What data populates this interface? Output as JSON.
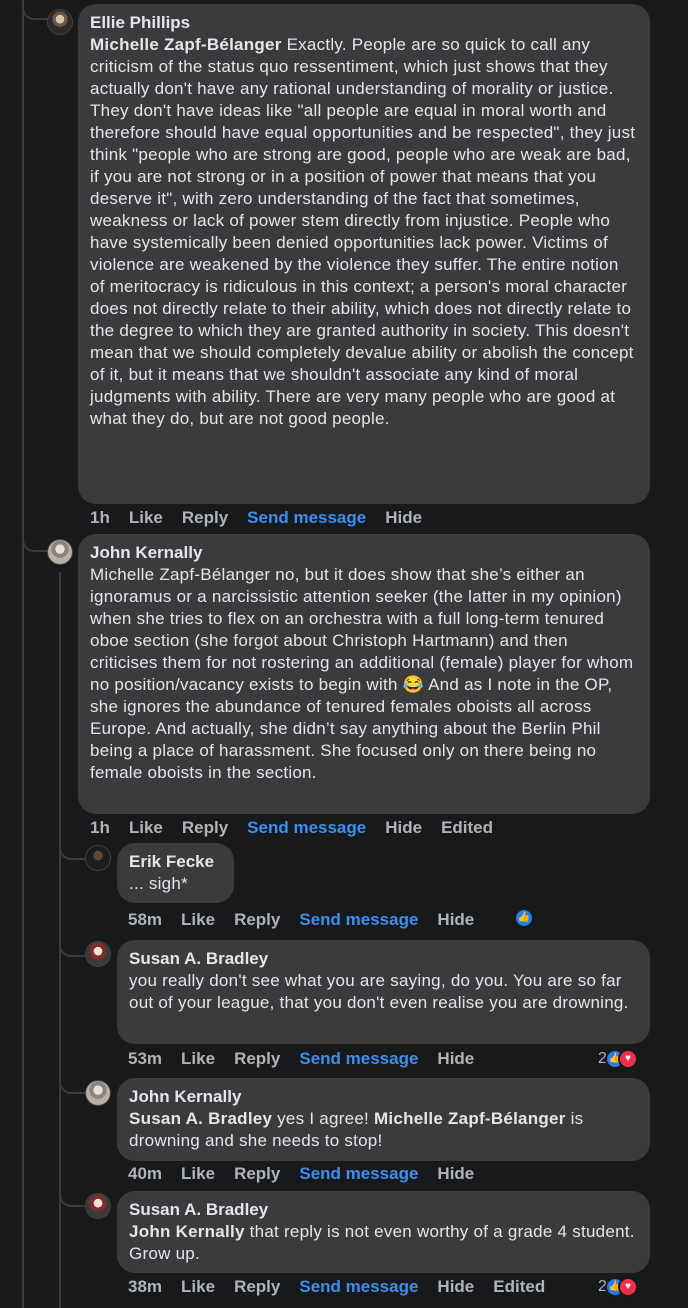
{
  "comments": [
    {
      "author": "Ellie Phillips",
      "mention": "Michelle Zapf-Bélanger",
      "text": " Exactly. People are so quick to call any criticism of the status quo ressentiment, which just shows that they actually don't have any rational understanding of morality or justice. They don't have ideas like \"all people are equal in moral worth and therefore should have equal opportunities and be respected\", they just think \"people who are strong are good, people who are weak are bad, if you are not strong or in a position of power that means that you deserve it\", with zero understanding of the fact that sometimes, weakness or lack of power stem directly from injustice. People who have systemically been denied opportunities lack power. Victims of violence are weakened by the violence they suffer. The entire notion of meritocracy is ridiculous in this context; a person's moral character does not directly relate to their ability, which does not directly relate to the degree to which they are granted authority in society. This doesn't mean that we should completely devalue ability or abolish the concept of it, but it means that we shouldn't associate any kind of moral judgments with ability. There are very many people who are good at what they do, but are not good people.",
      "time": "1h",
      "like": "Like",
      "reply": "Reply",
      "send": "Send message",
      "hide": "Hide"
    },
    {
      "author": "John Kernally",
      "text": "Michelle Zapf-Bélanger no, but it does show that she’s either an ignoramus or a narcissistic attention seeker (the latter in my opinion) when she tries to flex on an orchestra with a full long-term tenured oboe section (she forgot about Christoph Hartmann) and then criticises them for not rostering an additional (female) player for whom no position/vacancy exists to begin with 😂 And as I note in the OP, she ignores the abundance of tenured females oboists all across Europe. And actually, she didn’t say anything about the Berlin Phil being a place of harassment. She focused only on there being no female oboists in the section.",
      "time": "1h",
      "like": "Like",
      "reply": "Reply",
      "send": "Send message",
      "hide": "Hide",
      "edited": "Edited"
    },
    {
      "author": "Erik Fecke",
      "text": "... sigh*",
      "time": "58m",
      "like": "Like",
      "reply": "Reply",
      "send": "Send message",
      "hide": "Hide"
    },
    {
      "author": "Susan A. Bradley",
      "text": "you really don't see what you are saying, do you. You are so far out of your league, that you don't even realise you are drowning.",
      "time": "53m",
      "like": "Like",
      "reply": "Reply",
      "send": "Send message",
      "hide": "Hide",
      "reaction_count": "2"
    },
    {
      "author": "John Kernally",
      "mention1": "Susan A. Bradley",
      "text1": " yes I agree! ",
      "mention2": "Michelle Zapf-Bélanger",
      "text2": " is drowning and she needs to stop!",
      "time": "40m",
      "like": "Like",
      "reply": "Reply",
      "send": "Send message",
      "hide": "Hide"
    },
    {
      "author": "Susan A. Bradley",
      "mention": "John Kernally",
      "text": " that reply is not even worthy of a grade 4 student. Grow up.",
      "time": "38m",
      "like": "Like",
      "reply": "Reply",
      "send": "Send message",
      "hide": "Hide",
      "edited": "Edited",
      "reaction_count": "2"
    }
  ],
  "colors": {
    "background": "#18191a",
    "bubble": "#3a3b3c",
    "link": "#3d8ef0",
    "muted": "#b0b3b8",
    "like": "#1f7ef0",
    "love": "#f0304a"
  }
}
